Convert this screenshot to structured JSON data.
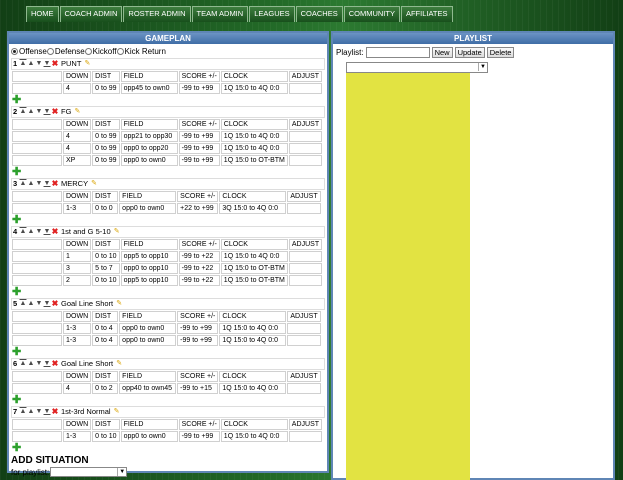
{
  "nav": [
    "HOME",
    "COACH ADMIN",
    "ROSTER ADMIN",
    "TEAM ADMIN",
    "LEAGUES",
    "COACHES",
    "COMMUNITY",
    "AFFILIATES"
  ],
  "gameplan": {
    "title": "GAMEPLAN",
    "radio_options": [
      {
        "label": "Offense",
        "selected": true
      },
      {
        "label": "Defense",
        "selected": false
      },
      {
        "label": "Kickoff",
        "selected": false
      },
      {
        "label": "Kick Return",
        "selected": false
      }
    ],
    "headers": [
      "DOWN",
      "DIST",
      "FIELD",
      "SCORE +/-",
      "CLOCK",
      "ADJUST"
    ],
    "situations": [
      {
        "num": "1",
        "name": "PUNT",
        "rows": [
          [
            "4",
            "0 to 99",
            "opp45 to own0",
            "-99 to +99",
            "1Q 15:0 to 4Q 0:0",
            ""
          ]
        ]
      },
      {
        "num": "2",
        "name": "FG",
        "rows": [
          [
            "4",
            "0 to 99",
            "opp21 to opp30",
            "-99 to +99",
            "1Q 15:0 to 4Q 0:0",
            ""
          ],
          [
            "4",
            "0 to 99",
            "opp0 to opp20",
            "-99 to +99",
            "1Q 15:0 to 4Q 0:0",
            ""
          ],
          [
            "XP",
            "0 to 99",
            "opp0 to own0",
            "-99 to +99",
            "1Q 15:0 to OT-BTM",
            ""
          ]
        ]
      },
      {
        "num": "3",
        "name": "MERCY",
        "rows": [
          [
            "1-3",
            "0 to 0",
            "opp0 to own0",
            "+22 to +99",
            "3Q 15:0 to 4Q 0:0",
            ""
          ]
        ]
      },
      {
        "num": "4",
        "name": "1st and G 5-10",
        "rows": [
          [
            "1",
            "0 to 10",
            "opp5 to opp10",
            "-99 to +22",
            "1Q 15:0 to 4Q 0:0",
            ""
          ],
          [
            "3",
            "5 to 7",
            "opp0 to opp10",
            "-99 to +22",
            "1Q 15:0 to OT-BTM",
            ""
          ],
          [
            "2",
            "0 to 10",
            "opp5 to opp10",
            "-99 to +22",
            "1Q 15:0 to OT-BTM",
            ""
          ]
        ]
      },
      {
        "num": "5",
        "name": "Goal Line Short",
        "rows": [
          [
            "1-3",
            "0 to 4",
            "opp0 to own0",
            "-99 to +99",
            "1Q 15:0 to 4Q 0:0",
            ""
          ],
          [
            "1-3",
            "0 to 4",
            "opp0 to own0",
            "-99 to +99",
            "1Q 15:0 to 4Q 0:0",
            ""
          ]
        ]
      },
      {
        "num": "6",
        "name": "Goal Line Short",
        "rows": [
          [
            "4",
            "0 to 2",
            "opp40 to own45",
            "-99 to +15",
            "1Q 15:0 to 4Q 0:0",
            ""
          ]
        ]
      },
      {
        "num": "7",
        "name": "1st-3rd Normal",
        "rows": [
          [
            "1-3",
            "0 to 10",
            "opp0 to own0",
            "-99 to +99",
            "1Q 15:0 to 4Q 0:0",
            ""
          ]
        ]
      }
    ],
    "add_situation": "ADD SITUATION",
    "for_playlist_label": "for playlist:",
    "for_playlist_value": ""
  },
  "playlist": {
    "title": "PLAYLIST",
    "label": "Playlist:",
    "input_value": "",
    "buttons": {
      "new": "New",
      "update": "Update",
      "delete": "Delete"
    },
    "select_value": "",
    "list_color": "#e2e342"
  },
  "icons": {
    "top": "arrow-top-icon",
    "up": "arrow-up-icon",
    "down": "arrow-down-icon",
    "bottom": "arrow-bottom-icon",
    "delete": "delete-x-icon",
    "edit": "pencil-icon",
    "add": "plus-icon"
  }
}
